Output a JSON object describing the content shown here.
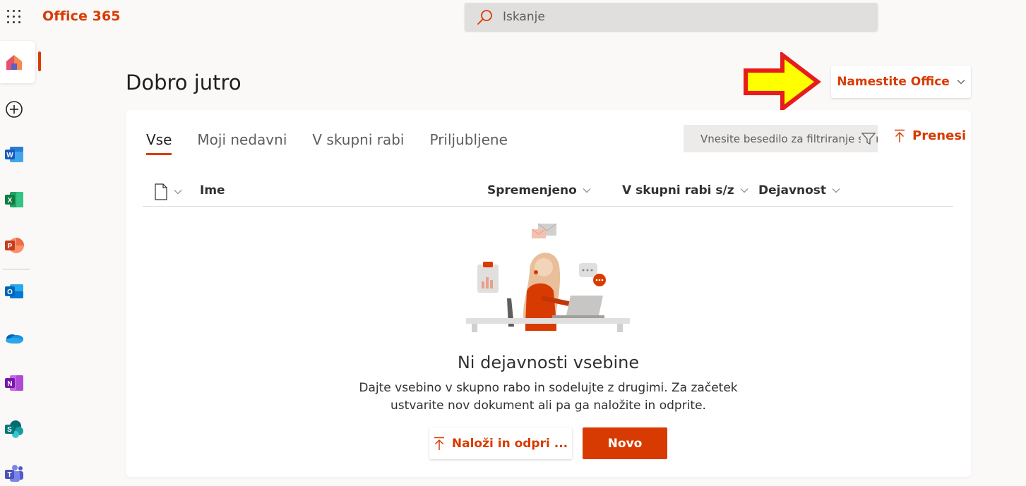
{
  "app": {
    "brand": "Office 365"
  },
  "search": {
    "placeholder": "Iskanje"
  },
  "greeting": "Dobro jutro",
  "install": {
    "label": "Namestite Office"
  },
  "tabs": [
    {
      "label": "Vse",
      "active": true
    },
    {
      "label": "Moji nedavni",
      "active": false
    },
    {
      "label": "V skupni rabi",
      "active": false
    },
    {
      "label": "Priljubljene",
      "active": false
    }
  ],
  "filter": {
    "placeholder": "Vnesite besedilo za filtriranje seznama"
  },
  "upload_top": {
    "label": "Prenesi"
  },
  "columns": {
    "name": "Ime",
    "modified": "Spremenjeno",
    "shared_with": "V skupni rabi s/z",
    "activity": "Dejavnost"
  },
  "empty_state": {
    "title": "Ni dejavnosti vsebine",
    "description": "Dajte vsebino v skupno rabo in sodelujte z drugimi. Za začetek ustvarite nov dokument ali pa ga naložite in odprite."
  },
  "buttons": {
    "upload_open": "Naloži in odpri ...",
    "new": "Novo"
  },
  "rail_icons": [
    "home-icon",
    "create-icon",
    "word-icon",
    "excel-icon",
    "powerpoint-icon",
    "outlook-icon",
    "onedrive-icon",
    "onenote-icon",
    "sharepoint-icon",
    "teams-icon"
  ],
  "colors": {
    "accent": "#d83b01",
    "arrow_fill": "#ffff00",
    "arrow_stroke": "#e81c1c"
  }
}
